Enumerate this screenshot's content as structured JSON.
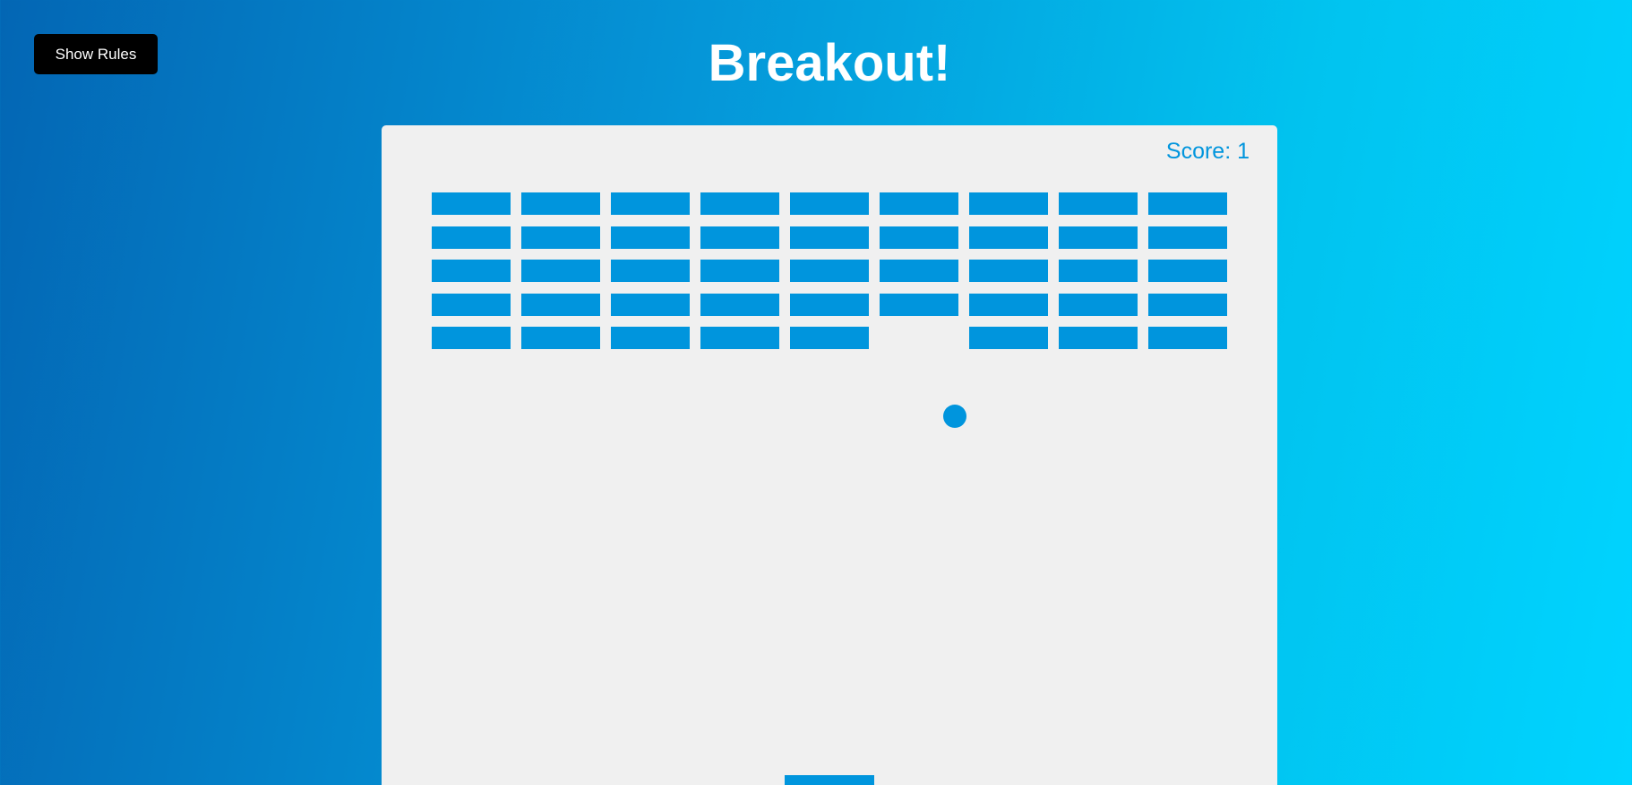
{
  "header": {
    "title": "Breakout!",
    "rules_button_label": "Show Rules"
  },
  "game": {
    "score_text": "Score: 1",
    "colors": {
      "background_start": "#0366b4",
      "background_end": "#00d4ff",
      "canvas": "#f0f0f0",
      "game_objects": "#0095dd",
      "button": "#000000"
    },
    "bricks": {
      "rows": 5,
      "columns": 9,
      "grid": [
        [
          1,
          1,
          1,
          1,
          1,
          1,
          1,
          1,
          1
        ],
        [
          1,
          1,
          1,
          1,
          1,
          1,
          1,
          1,
          1
        ],
        [
          1,
          1,
          1,
          1,
          1,
          1,
          1,
          1,
          1
        ],
        [
          1,
          1,
          1,
          1,
          1,
          1,
          1,
          1,
          1
        ],
        [
          1,
          1,
          1,
          1,
          1,
          0,
          1,
          1,
          1
        ]
      ]
    }
  }
}
